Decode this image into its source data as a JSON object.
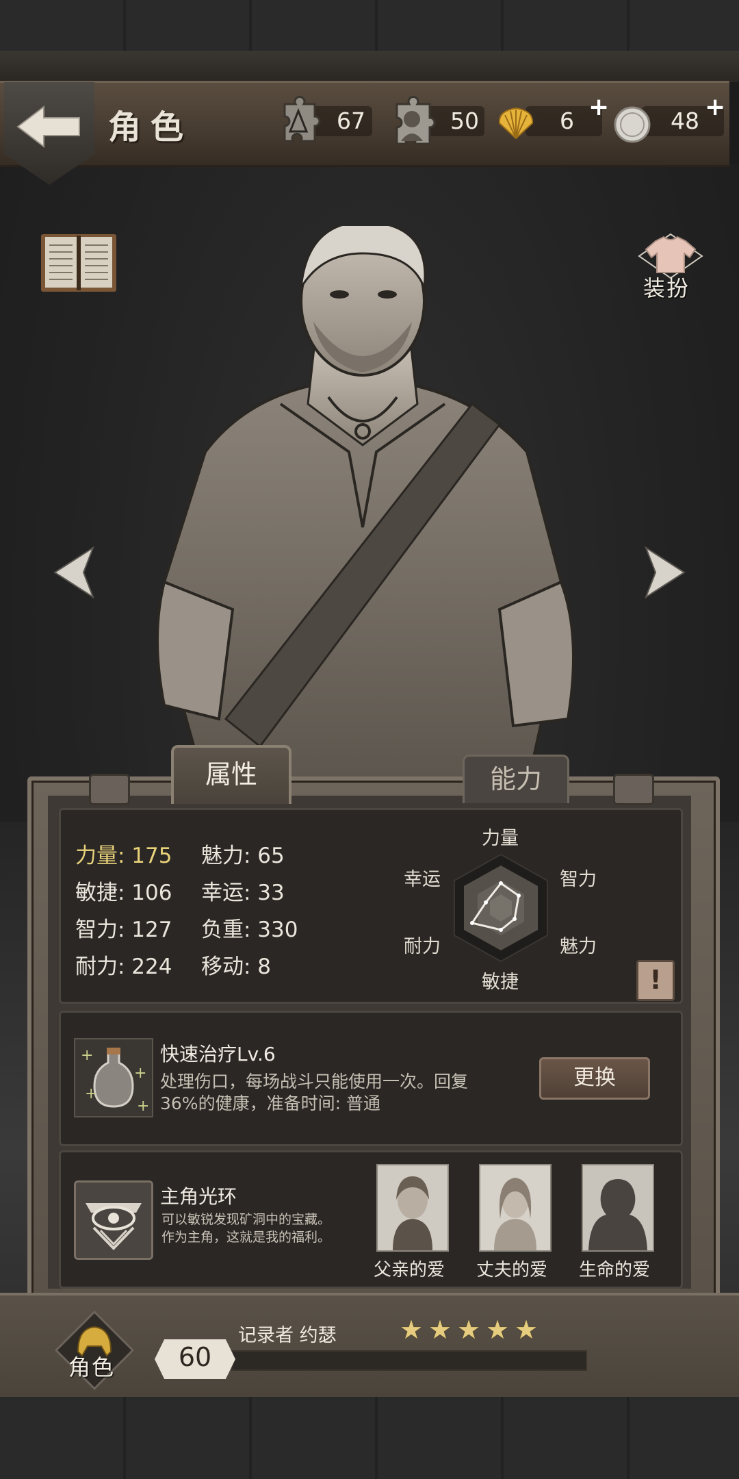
{
  "header": {
    "title": "角色",
    "resources": [
      {
        "icon": "puzzle-piece-icon",
        "value": "67"
      },
      {
        "icon": "character-puzzle-icon",
        "value": "50"
      },
      {
        "icon": "shell-icon",
        "value": "6",
        "plus": "+"
      },
      {
        "icon": "coin-icon",
        "value": "48",
        "plus": "+"
      }
    ]
  },
  "outfit_label": "装扮",
  "tabs": {
    "attributes": "属性",
    "ability": "能力"
  },
  "stats": [
    {
      "label": "力量: 175",
      "highlight": true
    },
    {
      "label": "魅力: 65"
    },
    {
      "label": "敏捷: 106"
    },
    {
      "label": "幸运: 33"
    },
    {
      "label": "智力: 127"
    },
    {
      "label": "负重: 330"
    },
    {
      "label": "耐力: 224"
    },
    {
      "label": "移动: 8"
    }
  ],
  "radar": {
    "labels": {
      "top": "力量",
      "top_right": "智力",
      "bottom_right": "魅力",
      "bottom": "敏捷",
      "bottom_left": "耐力",
      "top_left": "幸运"
    }
  },
  "info_button": "!",
  "skill": {
    "name": "快速治疗Lv.6",
    "desc_line1": "处理伤口，每场战斗只能使用一次。回复",
    "desc_line2": "36%的健康，准备时间: 普通",
    "button": "更换"
  },
  "halo": {
    "name": "主角光环",
    "desc_line1": "可以敏锐发现矿洞中的宝藏。",
    "desc_line2": "作为主角，这就是我的福利。"
  },
  "loves": [
    {
      "label": "父亲的爱"
    },
    {
      "label": "丈夫的爱"
    },
    {
      "label": "生命的爱"
    }
  ],
  "footer": {
    "role_label": "角色",
    "level": "60",
    "recorder": "记录者 约瑟",
    "stars": [
      "★",
      "★",
      "★",
      "★",
      "★"
    ]
  }
}
